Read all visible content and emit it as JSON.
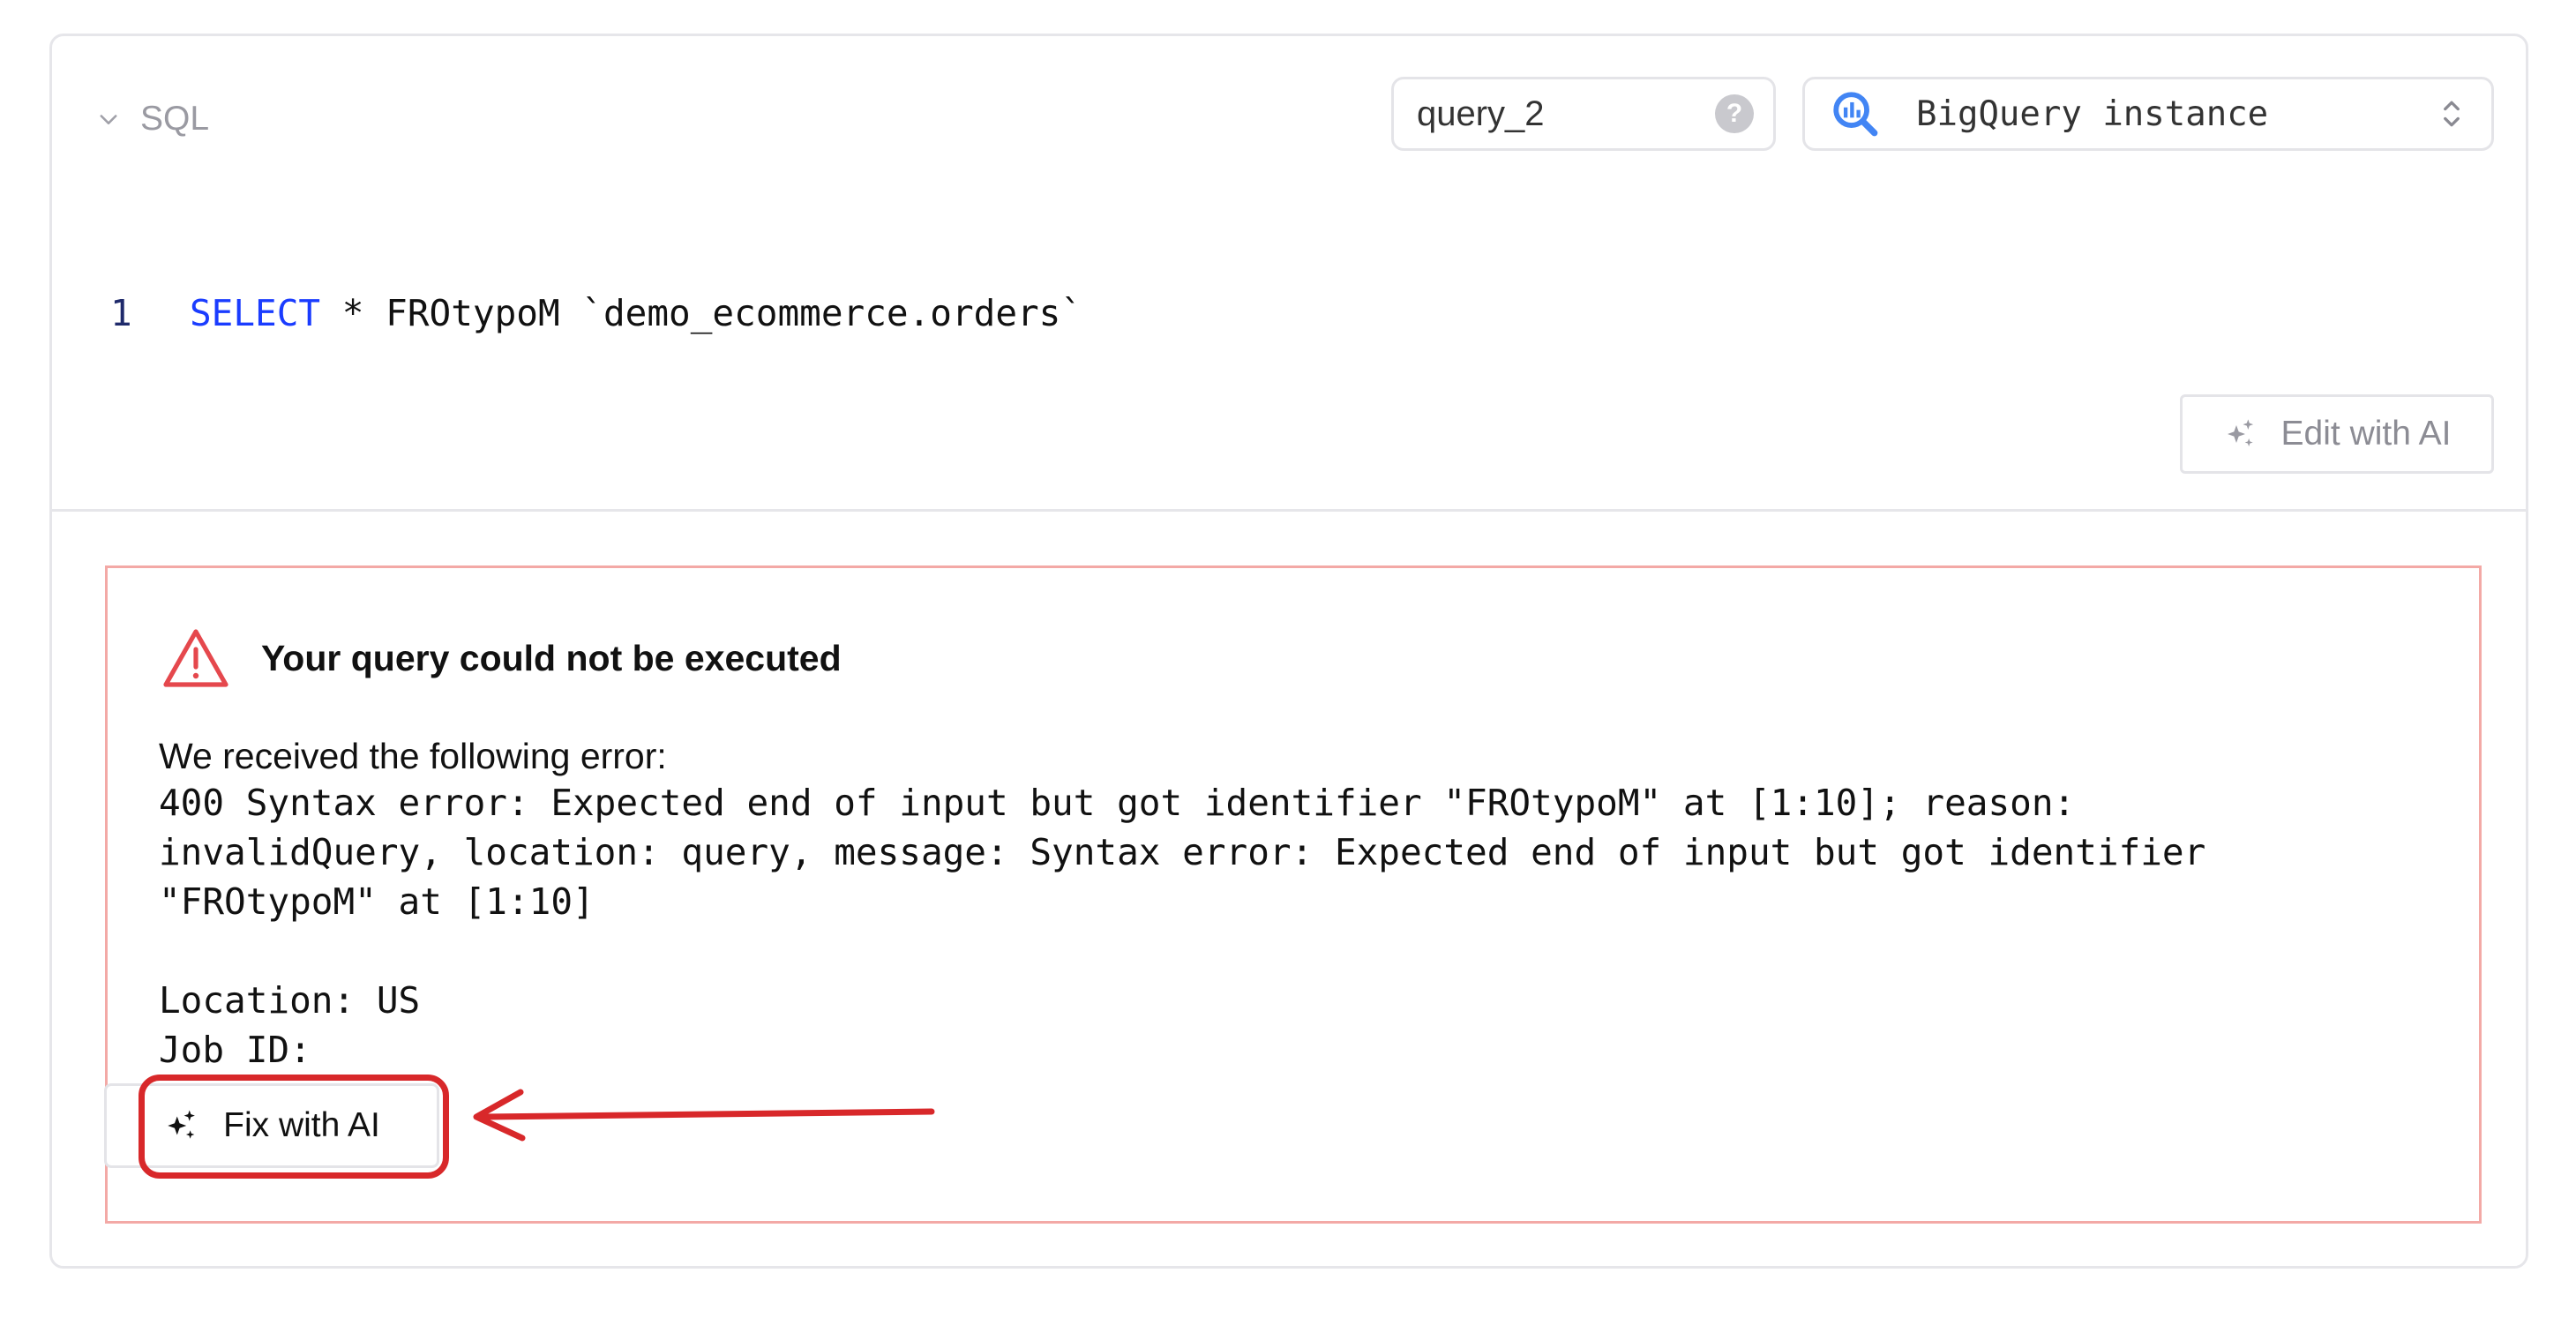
{
  "header": {
    "section_label": "SQL",
    "query_name": "query_2",
    "help_icon": "question-mark-icon",
    "data_source": "BigQuery instance",
    "data_source_icon": "bigquery-icon"
  },
  "editor": {
    "line_number": "1",
    "keyword": "SELECT",
    "code": " * FROtypoM `demo_ecommerce.orders`"
  },
  "edit_ai_label": "Edit with AI",
  "error": {
    "title": "Your query could not be executed",
    "intro": "We received the following error:",
    "lines": [
      "400 Syntax error: Expected end of input but got identifier \"FROtypoM\" at [1:10]; reason:",
      "invalidQuery, location: query, message: Syntax error: Expected end of input but got identifier",
      "\"FROtypoM\" at [1:10]",
      "",
      "Location: US",
      "Job ID:"
    ],
    "fix_label": "Fix with AI"
  },
  "colors": {
    "keyword": "#1a3cff",
    "error_border": "#f3a9a6",
    "warning_icon": "#e5484d",
    "annotation": "#d8282a"
  }
}
